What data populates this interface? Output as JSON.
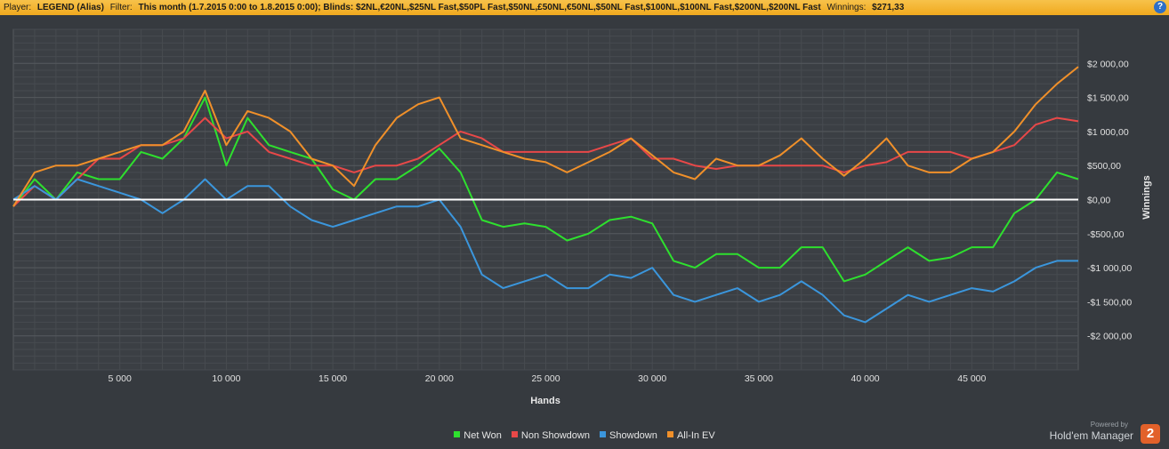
{
  "header": {
    "player_label": "Player:",
    "player_value": "LEGEND (Alias)",
    "filter_label": "Filter:",
    "filter_value": "This month (1.7.2015 0:00 to 1.8.2015 0:00); Blinds: $2NL,€20NL,$25NL Fast,$50PL Fast,$50NL,£50NL,€50NL,$50NL Fast,$100NL,$100NL Fast,$200NL,$200NL Fast",
    "winnings_label": "Winnings:",
    "winnings_value": "$271,33",
    "help_glyph": "?"
  },
  "legend_items": [
    {
      "label": "Net Won",
      "color": "#2ee02e"
    },
    {
      "label": "Non Showdown",
      "color": "#e84848"
    },
    {
      "label": "Showdown",
      "color": "#3b96dc"
    },
    {
      "label": "All-In EV",
      "color": "#f0902a"
    }
  ],
  "branding": {
    "powered_by": "Powered by",
    "product": "Hold'em Manager",
    "logo_text": "2"
  },
  "chart_data": {
    "type": "line",
    "xlabel": "Hands",
    "ylabel": "Winnings",
    "xlim": [
      0,
      50000
    ],
    "ylim": [
      -2500,
      2500
    ],
    "x_ticks": [
      5000,
      10000,
      15000,
      20000,
      25000,
      30000,
      35000,
      40000,
      45000
    ],
    "x_tick_labels": [
      "5 000",
      "10 000",
      "15 000",
      "20 000",
      "25 000",
      "30 000",
      "35 000",
      "40 000",
      "45 000"
    ],
    "y_ticks": [
      2000,
      1500,
      1000,
      500,
      0,
      -500,
      -1000,
      -1500,
      -2000
    ],
    "y_tick_labels": [
      "$2 000,00",
      "$1 500,00",
      "$1 000,00",
      "$500,00",
      "$0,00",
      "-$500,00",
      "-$1 000,00",
      "-$1 500,00",
      "-$2 000,00"
    ],
    "x": [
      0,
      1000,
      2000,
      3000,
      4000,
      5000,
      6000,
      7000,
      8000,
      9000,
      10000,
      11000,
      12000,
      13000,
      14000,
      15000,
      16000,
      17000,
      18000,
      19000,
      20000,
      21000,
      22000,
      23000,
      24000,
      25000,
      26000,
      27000,
      28000,
      29000,
      30000,
      31000,
      32000,
      33000,
      34000,
      35000,
      36000,
      37000,
      38000,
      39000,
      40000,
      41000,
      42000,
      43000,
      44000,
      45000,
      46000,
      47000,
      48000,
      49000,
      50000
    ],
    "series": [
      {
        "name": "Net Won",
        "color": "#2ee02e",
        "values": [
          -100,
          300,
          0,
          400,
          300,
          300,
          700,
          600,
          900,
          1500,
          500,
          1200,
          800,
          700,
          600,
          150,
          0,
          300,
          300,
          500,
          750,
          400,
          -300,
          -400,
          -350,
          -400,
          -600,
          -500,
          -300,
          -250,
          -350,
          -900,
          -1000,
          -800,
          -800,
          -1000,
          -1000,
          -700,
          -700,
          -1200,
          -1100,
          -900,
          -700,
          -900,
          -850,
          -700,
          -700,
          -200,
          0,
          400,
          300
        ]
      },
      {
        "name": "Non Showdown",
        "color": "#e84848",
        "values": [
          -100,
          200,
          0,
          300,
          600,
          600,
          800,
          800,
          900,
          1200,
          900,
          1000,
          700,
          600,
          500,
          500,
          400,
          500,
          500,
          600,
          800,
          1000,
          900,
          700,
          700,
          700,
          700,
          700,
          800,
          900,
          600,
          600,
          500,
          450,
          500,
          500,
          500,
          500,
          500,
          400,
          500,
          550,
          700,
          700,
          700,
          600,
          700,
          800,
          1100,
          1200,
          1150
        ]
      },
      {
        "name": "Showdown",
        "color": "#3b96dc",
        "values": [
          0,
          200,
          0,
          300,
          200,
          100,
          0,
          -200,
          0,
          300,
          0,
          200,
          200,
          -100,
          -300,
          -400,
          -300,
          -200,
          -100,
          -100,
          0,
          -400,
          -1100,
          -1300,
          -1200,
          -1100,
          -1300,
          -1300,
          -1100,
          -1150,
          -1000,
          -1400,
          -1500,
          -1400,
          -1300,
          -1500,
          -1400,
          -1200,
          -1400,
          -1700,
          -1800,
          -1600,
          -1400,
          -1500,
          -1400,
          -1300,
          -1350,
          -1200,
          -1000,
          -900,
          -900
        ]
      },
      {
        "name": "All-In EV",
        "color": "#f0902a",
        "values": [
          -100,
          400,
          500,
          500,
          600,
          700,
          800,
          800,
          1000,
          1600,
          800,
          1300,
          1200,
          1000,
          600,
          500,
          200,
          800,
          1200,
          1400,
          1500,
          900,
          800,
          700,
          600,
          550,
          400,
          550,
          700,
          900,
          650,
          400,
          300,
          600,
          500,
          500,
          650,
          900,
          600,
          350,
          600,
          900,
          500,
          400,
          400,
          600,
          700,
          1000,
          1400,
          1700,
          1950
        ]
      }
    ]
  }
}
